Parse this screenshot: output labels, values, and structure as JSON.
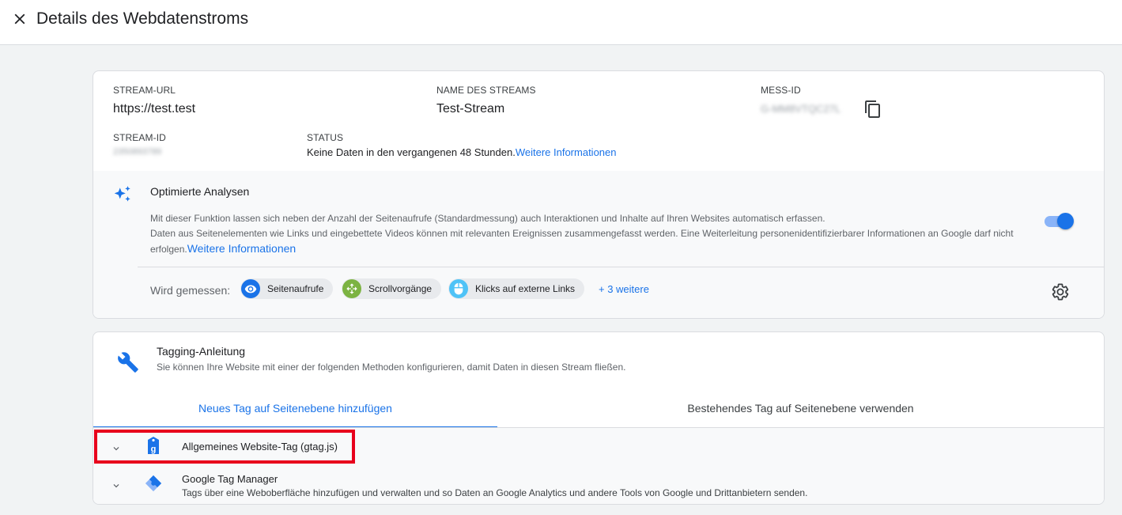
{
  "header": {
    "title": "Details des Webdatenstroms"
  },
  "stream": {
    "url_label": "STREAM-URL",
    "url_value": "https://test.test",
    "name_label": "NAME DES STREAMS",
    "name_value": "Test-Stream",
    "mess_label": "MESS-ID",
    "mess_value": "G-MM8VTQC27L",
    "id_label": "STREAM-ID",
    "id_value": "2350893789",
    "status_label": "STATUS",
    "status_text": "Keine Daten in den vergangenen 48 Stunden.",
    "status_link": "Weitere Informationen"
  },
  "enhanced": {
    "title": "Optimierte Analysen",
    "desc_line1": "Mit dieser Funktion lassen sich neben der Anzahl der Seitenaufrufe (Standardmessung) auch Interaktionen und Inhalte auf Ihren Websites automatisch erfassen.",
    "desc_line2": "Daten aus Seitenelementen wie Links und eingebettete Videos können mit relevanten Ereignissen zusammengefasst werden. Eine Weiterleitung personenidentifizierbarer Informationen an Google darf nicht",
    "desc_line3": "erfolgen.",
    "desc_link": "Weitere Informationen",
    "toggle_on": true,
    "measured_label": "Wird gemessen:",
    "chips": [
      {
        "label": "Seitenaufrufe",
        "icon": "eye-icon",
        "color": "#1a73e8"
      },
      {
        "label": "Scrollvorgänge",
        "icon": "scroll-icon",
        "color": "#7cb342"
      },
      {
        "label": "Klicks auf externe Links",
        "icon": "mouse-icon",
        "color": "#4fc3f7"
      }
    ],
    "more_link": "+ 3 weitere"
  },
  "tagging": {
    "title": "Tagging-Anleitung",
    "subtitle": "Sie können Ihre Website mit einer der folgenden Methoden konfigurieren, damit Daten in diesen Stream fließen.",
    "tabs": [
      {
        "label": "Neues Tag auf Seitenebene hinzufügen",
        "active": true
      },
      {
        "label": "Bestehendes Tag auf Seitenebene verwenden",
        "active": false
      }
    ],
    "items": [
      {
        "title": "Allgemeines Website-Tag (gtag.js)",
        "icon": "gtag-icon"
      },
      {
        "title": "Google Tag Manager",
        "subtitle": "Tags über eine Weboberfläche hinzufügen und verwalten und so Daten an Google Analytics und andere Tools von Google und Drittanbietern senden.",
        "icon": "gtm-icon"
      }
    ]
  },
  "colors": {
    "accent": "#1a73e8",
    "highlight": "#e8001c"
  }
}
